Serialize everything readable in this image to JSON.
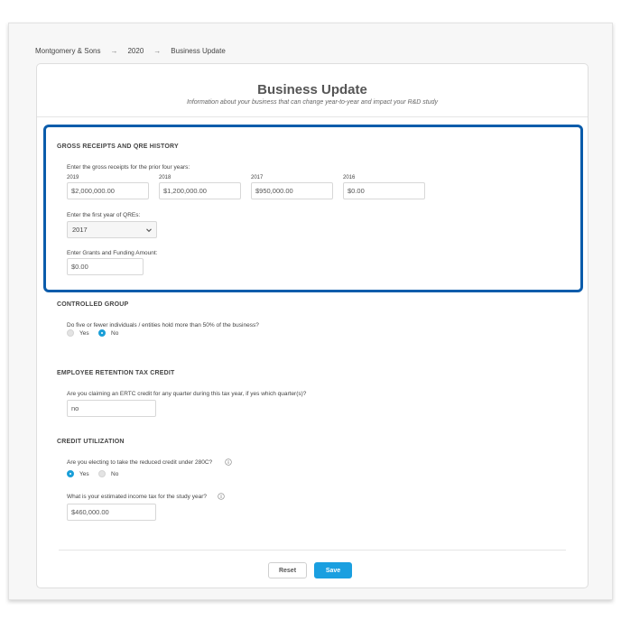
{
  "breadcrumb": {
    "items": [
      "Montgomery & Sons",
      "2020",
      "Business Update"
    ],
    "separator": "→"
  },
  "page": {
    "title": "Business Update",
    "subtitle": "Information about your business that can change year-to-year and impact your R&D study"
  },
  "gross_receipts": {
    "title": "GROSS RECEIPTS AND QRE HISTORY",
    "prompt": "Enter the gross receipts for the prior four years:",
    "years": [
      {
        "year": "2019",
        "value": "$2,000,000.00"
      },
      {
        "year": "2018",
        "value": "$1,200,000.00"
      },
      {
        "year": "2017",
        "value": "$950,000.00"
      },
      {
        "year": "2016",
        "value": "$0.00"
      }
    ],
    "first_qre_label": "Enter the first year of QREs:",
    "first_qre_value": "2017",
    "grants_label": "Enter Grants and Funding Amount:",
    "grants_value": "$0.00"
  },
  "controlled_group": {
    "title": "CONTROLLED GROUP",
    "question": "Do five or fewer individuals / entities hold more than 50% of the business?",
    "yes_label": "Yes",
    "no_label": "No",
    "selected": "No"
  },
  "ertc": {
    "title": "EMPLOYEE RETENTION TAX CREDIT",
    "question": "Are you claiming an ERTC credit for any quarter during this tax year, if yes which quarter(s)?",
    "value": "no"
  },
  "credit_utilization": {
    "title": "CREDIT UTILIZATION",
    "reduced_credit_question": "Are you electing to take the reduced credit under 280C?",
    "yes_label": "Yes",
    "no_label": "No",
    "selected": "Yes",
    "income_tax_question": "What is your estimated income tax for the study year?",
    "income_tax_value": "$460,000.00"
  },
  "actions": {
    "reset_label": "Reset",
    "save_label": "Save"
  },
  "colors": {
    "highlight_border": "#0b5cab",
    "accent": "#1a9fe0"
  }
}
